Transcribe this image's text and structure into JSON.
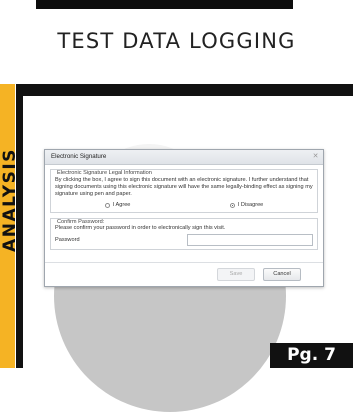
{
  "header": {
    "title": "TEST DATA LOGGING"
  },
  "sidebar": {
    "label": "ANALYSIS",
    "color": "#f5b324"
  },
  "dialog": {
    "title": "Electronic Signature",
    "close_icon": "close-icon",
    "legal": {
      "legend": "Electronic Signature Legal Information",
      "text": "By clicking the box, I agree to sign this document with an electronic signature. I further understand that signing documents using this electronic signature will have the same legally-binding effect as signing my signature using pen and paper.",
      "agree_label": "I Agree",
      "disagree_label": "I Disagree",
      "selected": "I Disagree"
    },
    "password": {
      "legend": "Confirm Password:",
      "instructions": "Please confirm your password in order to electronically sign this visit.",
      "label": "Password",
      "value": ""
    },
    "buttons": {
      "save": "Save",
      "cancel": "Cancel"
    }
  },
  "footer": {
    "page_label": "Pg. 7"
  }
}
